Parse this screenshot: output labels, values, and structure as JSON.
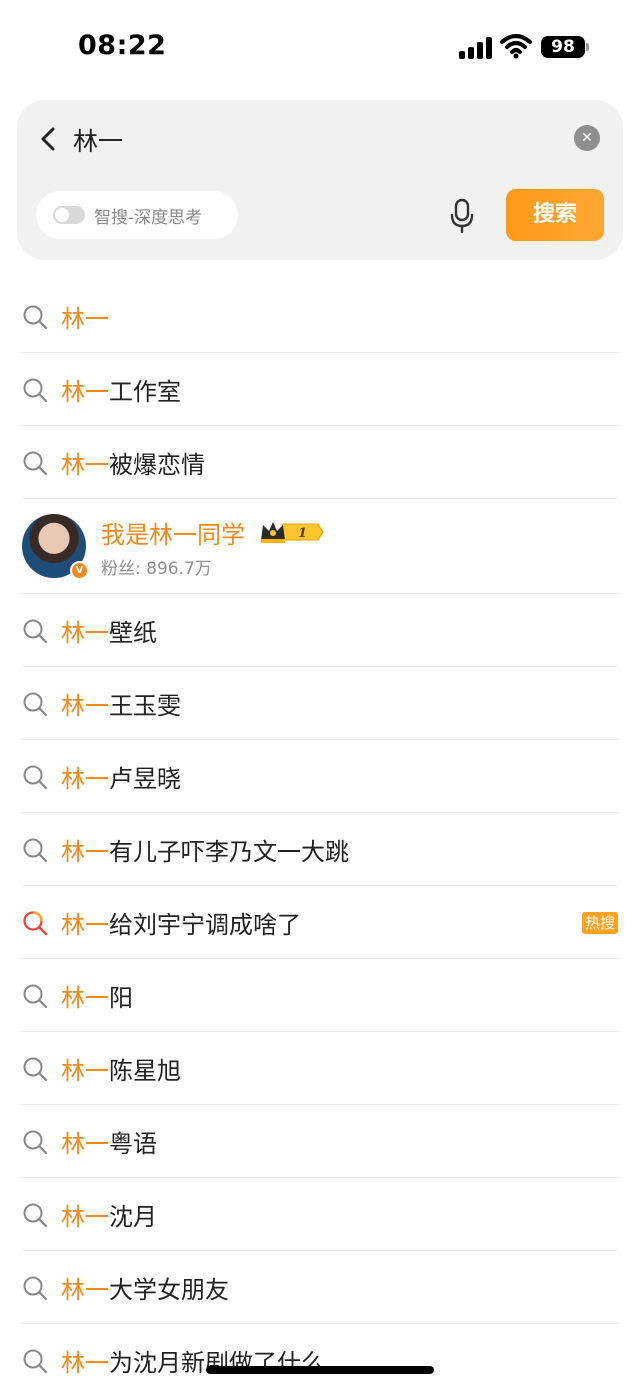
{
  "status_bar": {
    "time": "08:22",
    "battery": "98"
  },
  "search": {
    "query": "林一",
    "deep_toggle_label": "智搜-深度思考",
    "search_button": "搜索"
  },
  "suggestions_before": [
    {
      "highlight": "林一",
      "rest": ""
    },
    {
      "highlight": "林一",
      "rest": "工作室"
    },
    {
      "highlight": "林一",
      "rest": "被爆恋情"
    }
  ],
  "user_card": {
    "name": "我是林一同学",
    "level": "1",
    "fans": "粉丝: 896.7万"
  },
  "suggestions_after": [
    {
      "highlight": "林一",
      "rest": "壁纸",
      "hot": false
    },
    {
      "highlight": "林一",
      "rest": "王玉雯",
      "hot": false
    },
    {
      "highlight": "林一",
      "rest": "卢昱晓",
      "hot": false
    },
    {
      "highlight": "林一",
      "rest": "有儿子吓李乃文一大跳",
      "hot": false
    },
    {
      "highlight": "林一",
      "rest": "给刘宇宁调成啥了",
      "hot": true,
      "badge": "热搜"
    },
    {
      "highlight": "林一",
      "rest": "阳",
      "hot": false
    },
    {
      "highlight": "林一",
      "rest": "陈星旭",
      "hot": false
    },
    {
      "highlight": "林一",
      "rest": "粤语",
      "hot": false
    },
    {
      "highlight": "林一",
      "rest": "沈月",
      "hot": false
    },
    {
      "highlight": "林一",
      "rest": "大学女朋友",
      "hot": false
    },
    {
      "highlight": "林一",
      "rest": "为沈月新剧做了什么",
      "hot": false
    }
  ],
  "colors": {
    "accent": "#f08a1c",
    "hot_icon": "#e8443a",
    "button": "#ff9a1a"
  }
}
